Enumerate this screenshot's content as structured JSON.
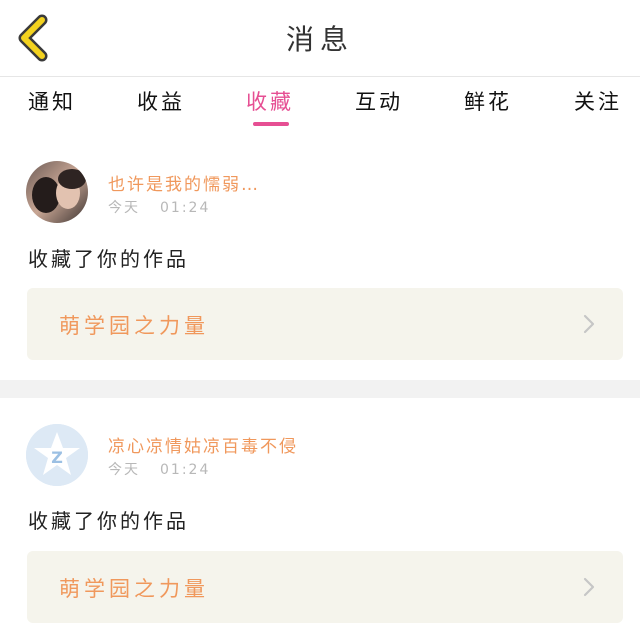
{
  "header": {
    "title": "消息",
    "back_icon": "chevron-left-icon",
    "back_color": "#f3d21f"
  },
  "tabs": [
    {
      "label": "通知"
    },
    {
      "label": "收益"
    },
    {
      "label": "收藏",
      "active": true
    },
    {
      "label": "互动"
    },
    {
      "label": "鲜花"
    },
    {
      "label": "关注"
    }
  ],
  "colors": {
    "accent": "#e64f93",
    "username": "#f0985c",
    "card_bg": "#f5f4ec"
  },
  "messages": [
    {
      "username": "也许是我的懦弱…",
      "date": "今天",
      "time": "01:24",
      "action": "收藏了你的作品",
      "work_title": "萌学园之力量",
      "avatar_icon": "photo-avatar"
    },
    {
      "username": "凉心凉情姑凉百毒不侵",
      "date": "今天",
      "time": "01:24",
      "action": "收藏了你的作品",
      "work_title": "萌学园之力量",
      "avatar_icon": "qq-default-avatar"
    }
  ]
}
